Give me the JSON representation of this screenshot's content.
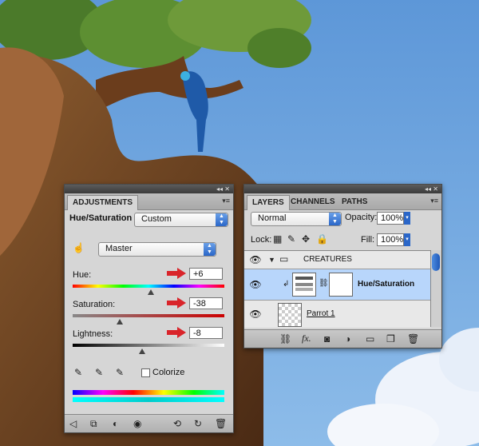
{
  "adjustments": {
    "tab_label": "ADJUSTMENTS",
    "adjustment_type": "Hue/Saturation",
    "preset_value": "Custom",
    "channel_value": "Master",
    "hue": {
      "label": "Hue:",
      "value": "+6",
      "thumb_fraction": 0.517
    },
    "saturation": {
      "label": "Saturation:",
      "value": "-38",
      "thumb_fraction": 0.31
    },
    "lightness": {
      "label": "Lightness:",
      "value": "-8",
      "thumb_fraction": 0.46
    },
    "colorize_label": "Colorize",
    "colorize_checked": false
  },
  "layers": {
    "tabs": [
      "LAYERS",
      "CHANNELS",
      "PATHS"
    ],
    "blend_mode": "Normal",
    "opacity_label": "Opacity:",
    "opacity_value": "100%",
    "lock_label": "Lock:",
    "fill_label": "Fill:",
    "fill_value": "100%",
    "rows": [
      {
        "name": "CREATURES",
        "kind": "group"
      },
      {
        "name": "Hue/Saturation",
        "kind": "adjustment",
        "selected": true
      },
      {
        "name": "Parrot 1",
        "kind": "layer"
      }
    ]
  },
  "colors": {
    "accent_arrow": "#d9242a",
    "selected_row": "#b8d6fb",
    "sky": "#6fa8e0"
  }
}
